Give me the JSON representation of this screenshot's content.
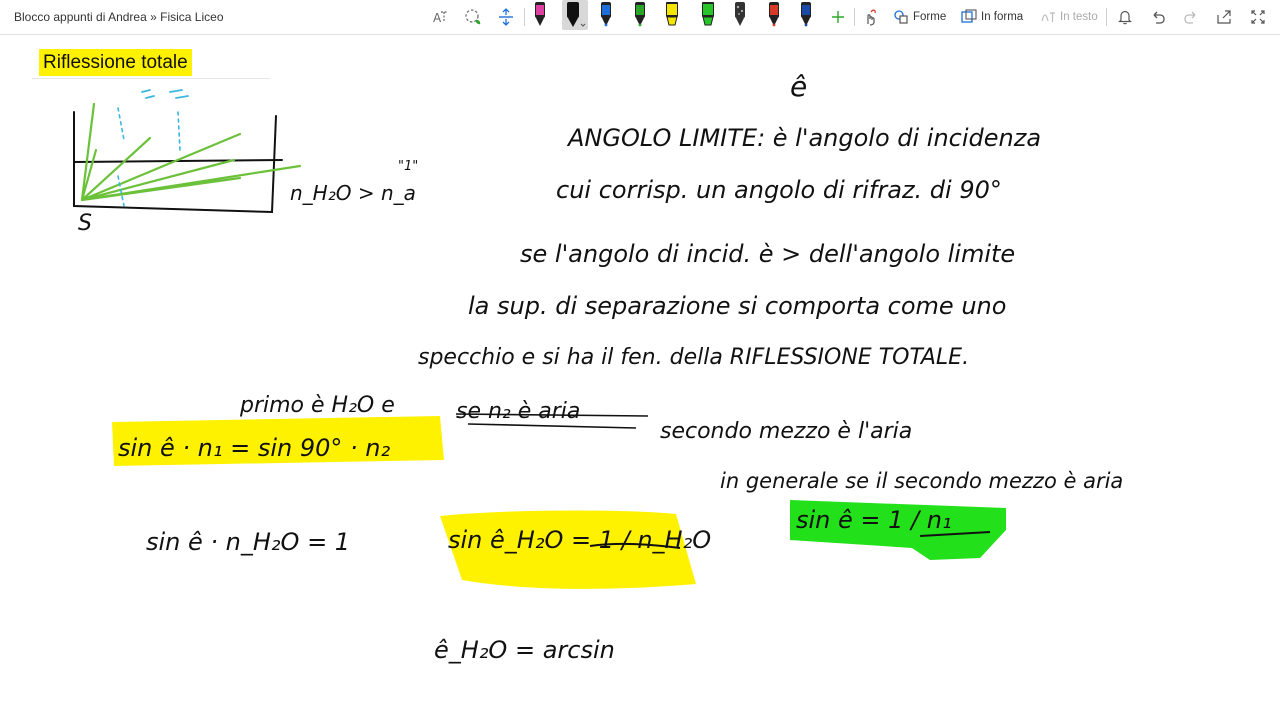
{
  "breadcrumb": {
    "notebook": "Blocco appunti di Andrea",
    "separator": "»",
    "section": "Fisica Liceo"
  },
  "toolbar": {
    "shapes_label": "Forme",
    "ink_to_shape_label": "In forma",
    "ink_to_text_label": "In testo",
    "pens": [
      {
        "name": "pen-pink",
        "color": "#e040a0"
      },
      {
        "name": "pen-black",
        "color": "#111111"
      },
      {
        "name": "pen-blue",
        "color": "#1e6fd9"
      },
      {
        "name": "pen-green",
        "color": "#2aa52a"
      },
      {
        "name": "highlighter-yellow",
        "color": "#f5e600"
      },
      {
        "name": "highlighter-green",
        "color": "#27c52a"
      },
      {
        "name": "pen-galaxy",
        "color": "#777777"
      },
      {
        "name": "pen-red",
        "color": "#d83a2a"
      },
      {
        "name": "pen-navy",
        "color": "#1a4aa8"
      }
    ]
  },
  "page": {
    "title": "Riflessione totale",
    "title_highlight": "#fff200"
  },
  "notes": {
    "e_hat": "ê",
    "line1": "ANGOLO LIMITE: è l'angolo di incidenza",
    "line2": "cui corrisp. un angolo di rifraz. di 90°",
    "line3": "se l'angolo di incid. è > dell'angolo limite",
    "line4": "la sup. di separazione si comporta come uno",
    "line5": "specchio e si ha il fen. della RIFLESSIONE TOTALE.",
    "line6_left": "primo è H₂O e",
    "line6_strike": "se n₂ è aria",
    "line6_right": "secondo mezzo è l'aria",
    "condition": "n_H₂O > n_a",
    "condition_mark": "\"1\"",
    "diagram_label": "S",
    "eq1": "sin ê · n₁ = sin 90° · n₂",
    "eq2": "sin ê · n_H₂O = 1",
    "eq3": "sin ê_H₂O = 1 / n_H₂O",
    "general": "in generale se il secondo mezzo è aria",
    "eq4": "sin ê = 1 / n₁",
    "eq5": "ê_H₂O = arcsin"
  },
  "colors": {
    "yellow_highlight": "#fff200",
    "green_highlight": "#22e01a",
    "ink": "#111111",
    "diagram_green": "#6cc13a",
    "diagram_cyan": "#3ab8e0"
  }
}
